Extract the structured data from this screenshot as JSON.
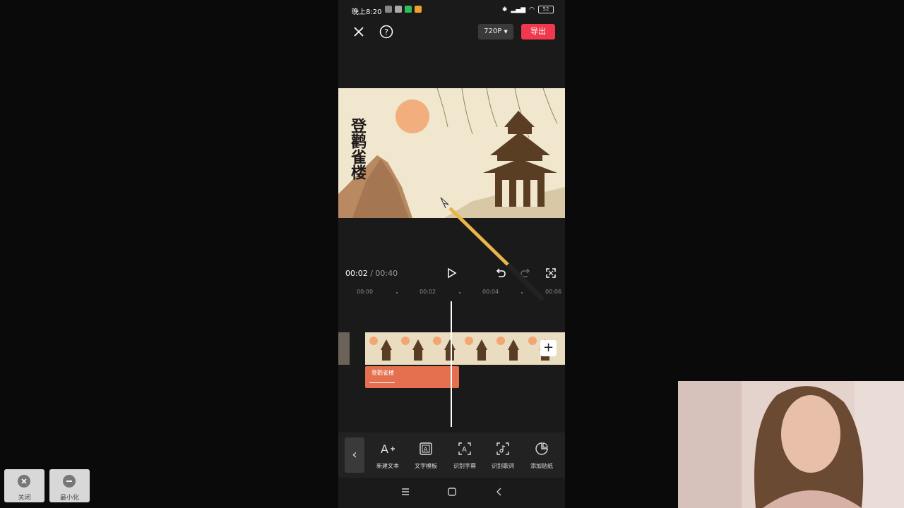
{
  "status_bar": {
    "time": "晚上8:20",
    "battery": "52"
  },
  "topbar": {
    "resolution": "720P",
    "export_label": "导出"
  },
  "preview": {
    "poem_title": "登鹳雀楼"
  },
  "playback": {
    "current_time": "00:02",
    "separator": " / ",
    "total_time": "00:40"
  },
  "ruler": {
    "ticks": [
      "00:00",
      "00:02",
      "00:04",
      "00:06"
    ]
  },
  "timeline": {
    "text_clip_label": "登鹳雀楼",
    "add_symbol": "+"
  },
  "toolbar": {
    "back_symbol": "‹",
    "items": [
      {
        "label": "新建文本",
        "icon": "text-add-icon"
      },
      {
        "label": "文字模板",
        "icon": "text-template-icon"
      },
      {
        "label": "识别字幕",
        "icon": "recognize-subtitle-icon"
      },
      {
        "label": "识别歌词",
        "icon": "recognize-lyrics-icon"
      },
      {
        "label": "添加贴纸",
        "icon": "sticker-icon"
      }
    ]
  },
  "window_controls": {
    "close_label": "关闭",
    "minimize_label": "最小化"
  },
  "colors": {
    "export": "#f0394f",
    "text_clip": "#e5704f",
    "background": "#0a0a0a"
  }
}
